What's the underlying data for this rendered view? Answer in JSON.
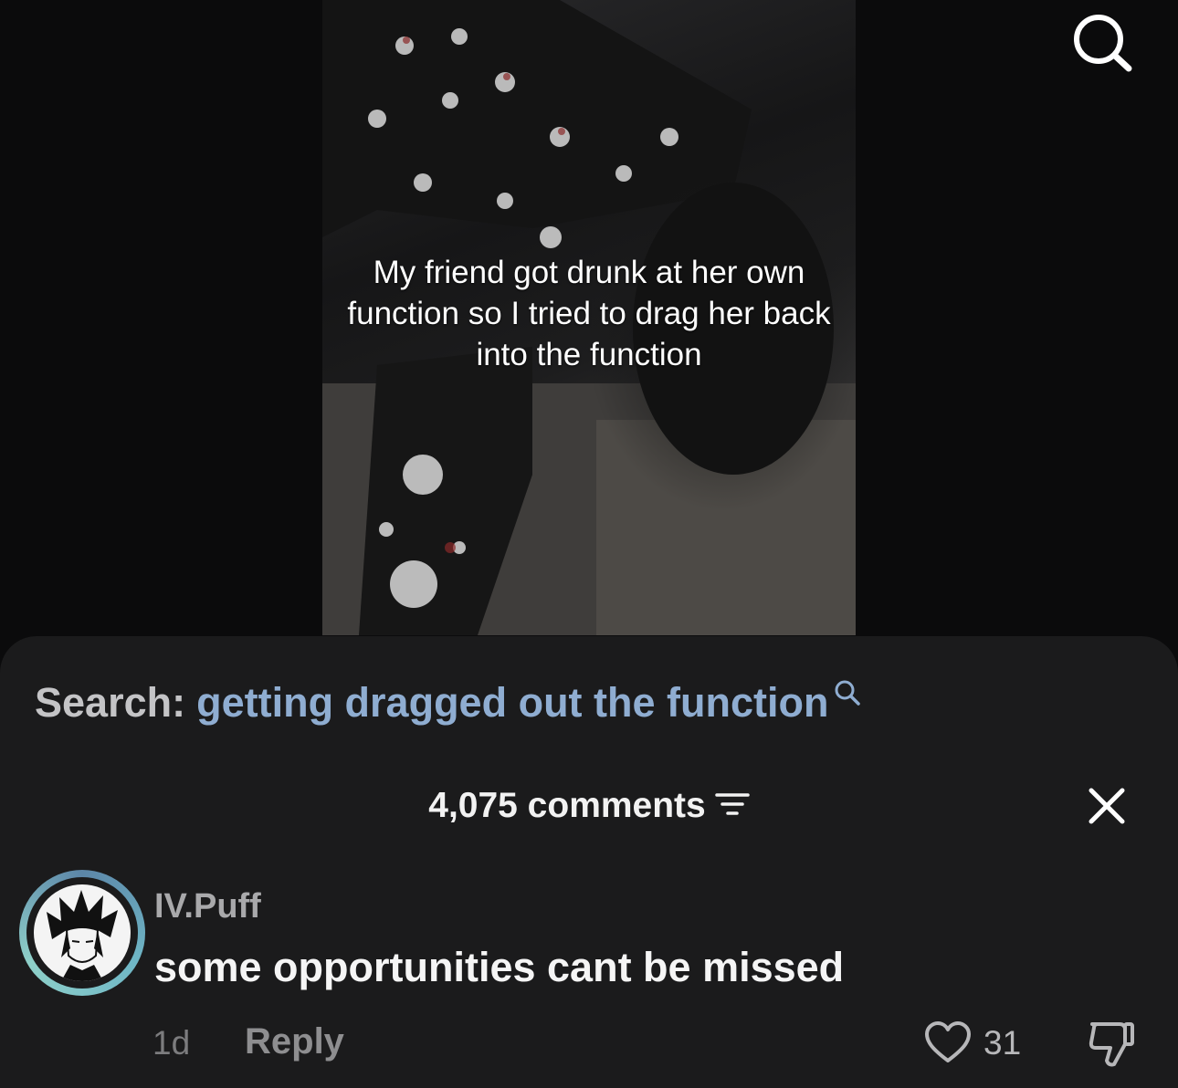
{
  "video": {
    "caption": "My friend got drunk at her own function so I tried to drag her back into the function"
  },
  "search": {
    "prefix": "Search:",
    "term": "getting dragged out the function"
  },
  "comments_header": {
    "count_label": "4,075 comments"
  },
  "comment": {
    "username": "IV.Puff",
    "text": "some opportunities cant be missed",
    "time": "1d",
    "reply_label": "Reply",
    "likes": "31"
  },
  "colors": {
    "search_term": "#8fadd1",
    "sheet_bg": "#1b1b1c"
  },
  "icons": [
    "search-icon",
    "search-small-icon",
    "filter-icon",
    "close-icon",
    "heart-icon",
    "dislike-icon"
  ]
}
